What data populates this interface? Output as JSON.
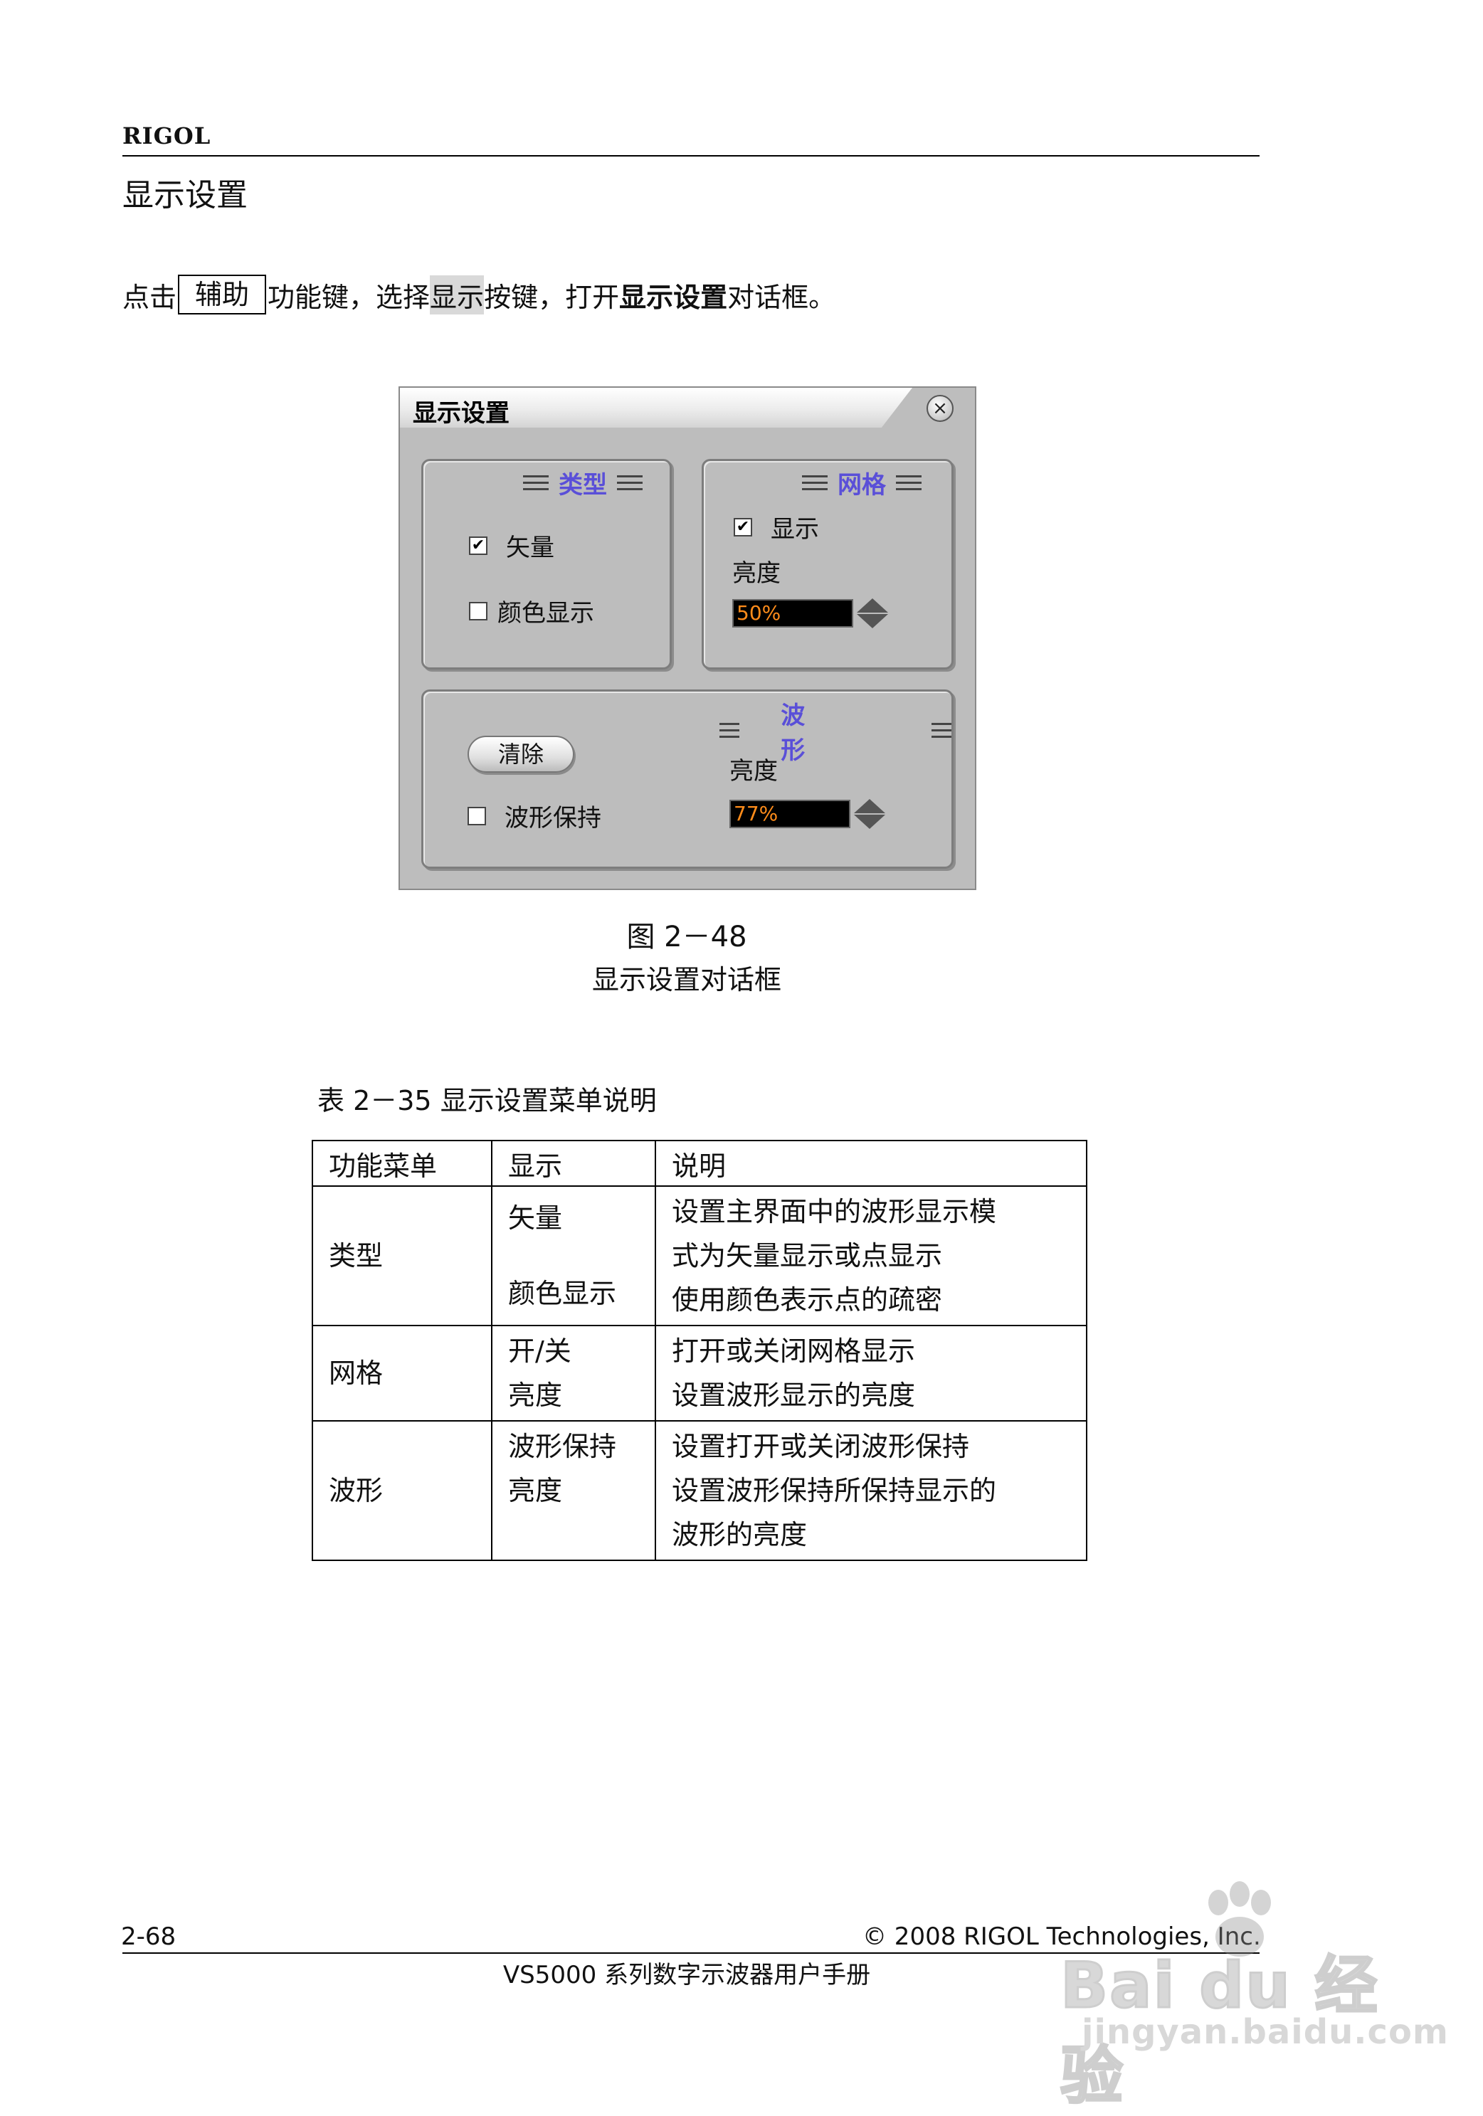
{
  "header": {
    "brand": "RIGOL",
    "section_title": "显示设置"
  },
  "intro": {
    "prefix": "点击",
    "key": "辅助",
    "mid": "功能键，选择",
    "softkey": "显示",
    "mid2": "按键，打开",
    "dialog_name": "显示设置",
    "suffix": "对话框。"
  },
  "dialog": {
    "title": "显示设置",
    "close_glyph": "×",
    "type_panel": {
      "title": "类型",
      "vector": {
        "label": "矢量",
        "checked": true
      },
      "color_display": {
        "label": "颜色显示",
        "checked": false
      }
    },
    "grid_panel": {
      "title": "网格",
      "show": {
        "label": "显示",
        "checked": true
      },
      "brightness_label": "亮度",
      "brightness_value": "50%"
    },
    "wave_panel": {
      "title": "波形",
      "clear_label": "清除",
      "hold": {
        "label": "波形保持",
        "checked": false
      },
      "brightness_label": "亮度",
      "brightness_value": "77%"
    }
  },
  "figure": {
    "number": "图 2－48",
    "caption": "显示设置对话框"
  },
  "table": {
    "title": "表 2－35  显示设置菜单说明",
    "headers": [
      "功能菜单",
      "显示",
      "说明"
    ],
    "rows": [
      {
        "menu": "类型",
        "display": [
          "矢量",
          "",
          "颜色显示"
        ],
        "desc": [
          "设置主界面中的波形显示模",
          "式为矢量显示或点显示",
          "使用颜色表示点的疏密"
        ]
      },
      {
        "menu": "网格",
        "display": [
          "开/关",
          "亮度"
        ],
        "desc": [
          "打开或关闭网格显示",
          "设置波形显示的亮度"
        ]
      },
      {
        "menu": "波形",
        "display": [
          "波形保持",
          "亮度",
          ""
        ],
        "desc": [
          "设置打开或关闭波形保持",
          "设置波形保持所保持显示的",
          "波形的亮度"
        ]
      }
    ]
  },
  "footer": {
    "page": "2-68",
    "copyright": "© 2008 RIGOL Technologies, Inc.",
    "manual": "VS5000 系列数字示波器用户手册"
  },
  "watermark": {
    "logo": "Bai du 经验",
    "url": "jingyan.baidu.com"
  },
  "colors": {
    "panel_title": "#5a4fd8",
    "field_text": "#ff8c1a",
    "dialog_bg": "#bdbdbd"
  },
  "icons": {
    "checkbox_mark": "✔",
    "close": "close-icon",
    "spinner": "spinner-arrows-icon"
  }
}
